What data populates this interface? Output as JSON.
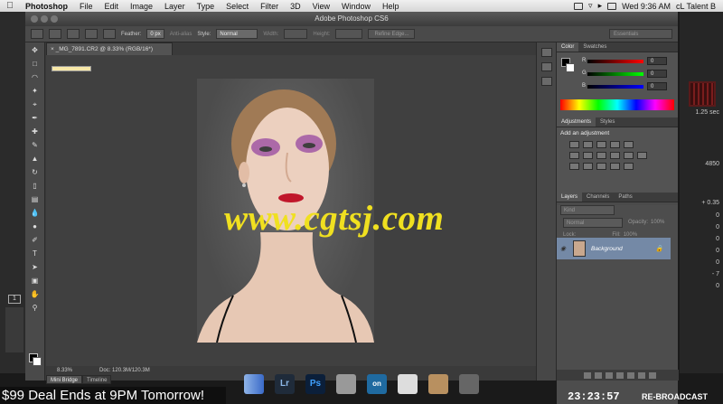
{
  "menubar": {
    "app": "Photoshop",
    "items": [
      "File",
      "Edit",
      "Image",
      "Layer",
      "Type",
      "Select",
      "Filter",
      "3D",
      "View",
      "Window",
      "Help"
    ],
    "clock": "Wed 9:36 AM",
    "user": "cL Talent B"
  },
  "window": {
    "title": "Adobe Photoshop CS6"
  },
  "options": {
    "feather_label": "Feather:",
    "feather_value": "0 px",
    "antialias_label": "Anti-alias",
    "style_label": "Style:",
    "style_value": "Normal",
    "width_label": "Width:",
    "height_label": "Height:",
    "refine_edge": "Refine Edge...",
    "workspace": "Essentials"
  },
  "document": {
    "tab": "_MG_7891.CR2 @ 8.33% (RGB/16*)",
    "zoom": "8.33%",
    "doc_size": "Doc: 120.3M/120.3M"
  },
  "bottom_tabs": [
    "Mini Bridge",
    "Timeline"
  ],
  "panels": {
    "color_tabs": [
      "Color",
      "Swatches"
    ],
    "color_values": {
      "R": "0",
      "G": "0",
      "B": "0"
    },
    "adjust_tabs": [
      "Adjustments",
      "Styles"
    ],
    "adjust_title": "Add an adjustment",
    "layers_tabs": [
      "Layers",
      "Channels",
      "Paths"
    ],
    "kind_label": "Kind",
    "blend_mode": "Normal",
    "opacity_label": "Opacity:",
    "opacity_value": "100%",
    "lock_label": "Lock:",
    "fill_label": "Fill:",
    "fill_value": "100%",
    "layer_name": "Background"
  },
  "dock": {
    "lr": "Lr",
    "ps": "Ps",
    "on": "on"
  },
  "watermark": "www.cgtsj.com",
  "overlay": {
    "deal": "$99 Deal Ends at 9PM Tomorrow!",
    "timer": "23:23:57",
    "rebroadcast": "RE-BROADCAST"
  },
  "right_app_values": [
    "1.25 sec",
    "4850",
    "+ 0.35",
    "0",
    "0",
    "0",
    "0",
    "0",
    "- 7",
    "0"
  ],
  "left_tray_number": "1"
}
